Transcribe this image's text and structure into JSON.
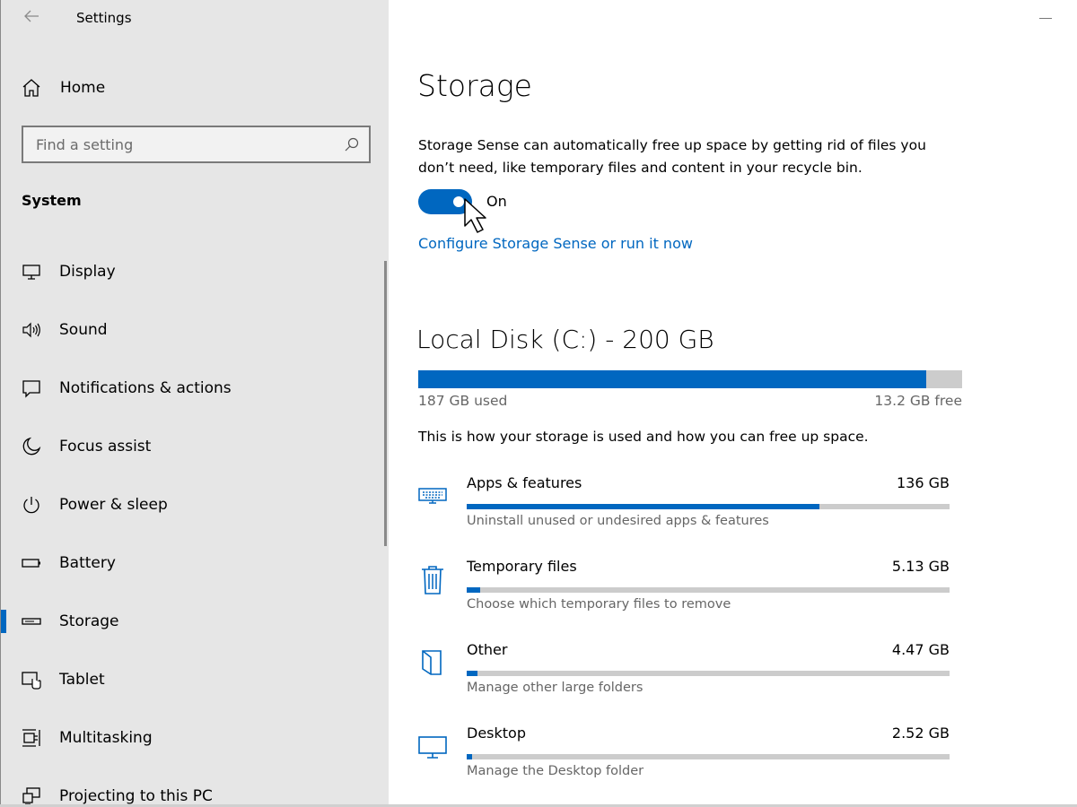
{
  "window": {
    "title": "Settings"
  },
  "sidebar": {
    "home_label": "Home",
    "search_placeholder": "Find a setting",
    "section_title": "System",
    "items": [
      {
        "label": "Display",
        "icon": "display-icon"
      },
      {
        "label": "Sound",
        "icon": "sound-icon"
      },
      {
        "label": "Notifications & actions",
        "icon": "notifications-icon"
      },
      {
        "label": "Focus assist",
        "icon": "focus-assist-icon"
      },
      {
        "label": "Power & sleep",
        "icon": "power-icon"
      },
      {
        "label": "Battery",
        "icon": "battery-icon"
      },
      {
        "label": "Storage",
        "icon": "storage-icon",
        "active": true
      },
      {
        "label": "Tablet",
        "icon": "tablet-icon"
      },
      {
        "label": "Multitasking",
        "icon": "multitasking-icon"
      },
      {
        "label": "Projecting to this PC",
        "icon": "projecting-icon"
      }
    ]
  },
  "main": {
    "title": "Storage",
    "description": "Storage Sense can automatically free up space by getting rid of files you don’t need, like temporary files and content in your recycle bin.",
    "toggle": {
      "state": "On",
      "on": true
    },
    "config_link": "Configure Storage Sense or run it now",
    "disk": {
      "title": "Local Disk (C:) - 200 GB",
      "used_label": "187 GB used",
      "free_label": "13.2 GB free",
      "used_fraction": 0.934
    },
    "usage_description": "This is how your storage is used and how you can free up space.",
    "categories": [
      {
        "name": "Apps & features",
        "size": "136 GB",
        "subtitle": "Uninstall unused or undesired apps & features",
        "fraction": 0.73,
        "icon": "keyboard-icon"
      },
      {
        "name": "Temporary files",
        "size": "5.13 GB",
        "subtitle": "Choose which temporary files to remove",
        "fraction": 0.027,
        "icon": "trash-icon"
      },
      {
        "name": "Other",
        "size": "4.47 GB",
        "subtitle": "Manage other large folders",
        "fraction": 0.022,
        "icon": "folder-icon"
      },
      {
        "name": "Desktop",
        "size": "2.52 GB",
        "subtitle": "Manage the Desktop folder",
        "fraction": 0.012,
        "icon": "monitor-icon"
      }
    ]
  },
  "colors": {
    "accent": "#0067c0",
    "sidebar_bg": "#e6e6e6",
    "bar_bg": "#cccccc"
  }
}
